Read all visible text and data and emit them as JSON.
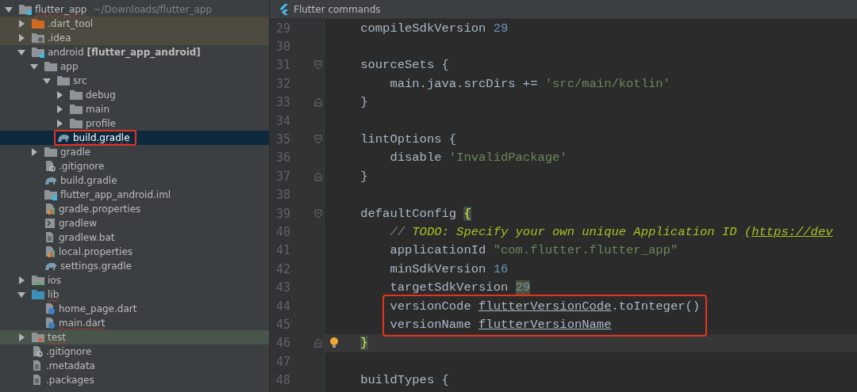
{
  "tree": [
    {
      "name": "flutter_app",
      "kind": "module",
      "path": "~/Downloads/flutter_app",
      "expanded": true,
      "selected": false,
      "typo": true,
      "annotated": false,
      "children": [
        {
          "name": ".dart_tool",
          "kind": "folder-excluded",
          "expanded": false,
          "selected": false,
          "typo": false,
          "annotated": false
        },
        {
          "name": ".idea",
          "kind": "folder-settings",
          "expanded": false,
          "selected": false,
          "typo": false,
          "annotated": false
        },
        {
          "name": "android",
          "kind": "module",
          "module": "[flutter_app_android]",
          "expanded": true,
          "selected": false,
          "typo": false,
          "annotated": false,
          "children": [
            {
              "name": "app",
              "kind": "folder",
              "expanded": true,
              "selected": false,
              "typo": false,
              "annotated": false,
              "children": [
                {
                  "name": "src",
                  "kind": "folder",
                  "expanded": true,
                  "selected": false,
                  "typo": false,
                  "annotated": false,
                  "children": [
                    {
                      "name": "debug",
                      "kind": "folder",
                      "expanded": false,
                      "selected": false,
                      "typo": false,
                      "annotated": false
                    },
                    {
                      "name": "main",
                      "kind": "folder",
                      "expanded": false,
                      "selected": false,
                      "typo": false,
                      "annotated": false
                    },
                    {
                      "name": "profile",
                      "kind": "folder",
                      "expanded": false,
                      "selected": false,
                      "typo": false,
                      "annotated": false
                    }
                  ]
                },
                {
                  "name": "build.gradle",
                  "kind": "gradle",
                  "selected": true,
                  "typo": true,
                  "annotated": true
                }
              ]
            },
            {
              "name": "gradle",
              "kind": "folder",
              "expanded": false,
              "selected": false,
              "typo": false,
              "annotated": false
            },
            {
              "name": ".gitignore",
              "kind": "ignore",
              "selected": false,
              "typo": false,
              "annotated": false
            },
            {
              "name": "build.gradle",
              "kind": "gradle",
              "selected": false,
              "typo": false,
              "annotated": false
            },
            {
              "name": "flutter_app_android.iml",
              "kind": "iml",
              "selected": false,
              "typo": false,
              "annotated": false
            },
            {
              "name": "gradle.properties",
              "kind": "properties",
              "selected": false,
              "typo": false,
              "annotated": false
            },
            {
              "name": "gradlew",
              "kind": "script",
              "selected": false,
              "typo": false,
              "annotated": false
            },
            {
              "name": "gradlew.bat",
              "kind": "text",
              "selected": false,
              "typo": false,
              "annotated": false
            },
            {
              "name": "local.properties",
              "kind": "properties",
              "selected": false,
              "typo": false,
              "annotated": false
            },
            {
              "name": "settings.gradle",
              "kind": "gradle",
              "selected": false,
              "typo": false,
              "annotated": false
            }
          ]
        },
        {
          "name": "ios",
          "kind": "folder-ios",
          "expanded": false,
          "selected": false,
          "typo": false,
          "annotated": false
        },
        {
          "name": "lib",
          "kind": "folder-source",
          "expanded": true,
          "selected": false,
          "typo": true,
          "annotated": false,
          "children": [
            {
              "name": "home_page.dart",
              "kind": "dart",
              "selected": false,
              "typo": false,
              "annotated": false
            },
            {
              "name": "main.dart",
              "kind": "dart",
              "selected": false,
              "typo": true,
              "annotated": false
            }
          ]
        },
        {
          "name": "test",
          "kind": "folder-test",
          "expanded": false,
          "selected": false,
          "typo": true,
          "annotated": false
        },
        {
          "name": ".gitignore",
          "kind": "ignore",
          "selected": false,
          "typo": false,
          "annotated": false
        },
        {
          "name": ".metadata",
          "kind": "text",
          "selected": false,
          "typo": false,
          "annotated": false
        },
        {
          "name": ".packages",
          "kind": "text",
          "selected": false,
          "typo": false,
          "annotated": false
        }
      ]
    }
  ],
  "editor": {
    "toolbar": {
      "title": "Flutter commands"
    },
    "lines": [
      {
        "number": "29",
        "current": false,
        "annotated": false,
        "kind": "plain",
        "tokens": [
          {
            "text": "    compileSdkVersion ",
            "kind": "plain"
          },
          {
            "text": "29",
            "kind": "number"
          }
        ]
      },
      {
        "number": "30",
        "current": false,
        "annotated": false,
        "kind": "plain"
      },
      {
        "number": "31",
        "current": false,
        "annotated": false,
        "kind": "fold-start",
        "tokens": [
          {
            "text": "    sourceSets {",
            "kind": "plain"
          }
        ]
      },
      {
        "number": "32",
        "current": false,
        "annotated": false,
        "kind": "plain",
        "tokens": [
          {
            "text": "        main.java.srcDirs += ",
            "kind": "plain"
          },
          {
            "text": "'src/main/kotlin'",
            "kind": "string"
          }
        ]
      },
      {
        "number": "33",
        "current": false,
        "annotated": false,
        "kind": "fold-end",
        "tokens": [
          {
            "text": "    }",
            "kind": "plain"
          }
        ]
      },
      {
        "number": "34",
        "current": false,
        "annotated": false,
        "kind": "plain"
      },
      {
        "number": "35",
        "current": false,
        "annotated": false,
        "kind": "fold-start",
        "tokens": [
          {
            "text": "    lintOptions {",
            "kind": "plain"
          }
        ]
      },
      {
        "number": "36",
        "current": false,
        "annotated": false,
        "kind": "plain",
        "tokens": [
          {
            "text": "        disable ",
            "kind": "plain"
          },
          {
            "text": "'InvalidPackage'",
            "kind": "string"
          }
        ]
      },
      {
        "number": "37",
        "current": false,
        "annotated": false,
        "kind": "fold-end",
        "tokens": [
          {
            "text": "    }",
            "kind": "plain"
          }
        ]
      },
      {
        "number": "38",
        "current": false,
        "annotated": false,
        "kind": "plain"
      },
      {
        "number": "39",
        "current": false,
        "annotated": false,
        "kind": "fold-start",
        "tokens": [
          {
            "text": "    defaultConfig ",
            "kind": "plain"
          },
          {
            "text": "{",
            "kind": "brace-match"
          }
        ]
      },
      {
        "number": "40",
        "current": false,
        "annotated": false,
        "kind": "plain",
        "tokens": [
          {
            "text": "        // ",
            "kind": "comment"
          },
          {
            "text": "TODO: Specify your own unique Application ID (",
            "kind": "todo"
          },
          {
            "text": "https://dev",
            "kind": "link"
          }
        ]
      },
      {
        "number": "41",
        "current": false,
        "annotated": false,
        "kind": "plain",
        "tokens": [
          {
            "text": "        applicationId ",
            "kind": "plain"
          },
          {
            "text": "\"com.flutter.flutter_app\"",
            "kind": "string"
          }
        ]
      },
      {
        "number": "42",
        "current": false,
        "annotated": false,
        "kind": "plain",
        "tokens": [
          {
            "text": "        minSdkVersion ",
            "kind": "plain"
          },
          {
            "text": "16",
            "kind": "number"
          }
        ]
      },
      {
        "number": "43",
        "current": false,
        "annotated": false,
        "kind": "plain",
        "tokens": [
          {
            "text": "        targetSdkVersion ",
            "kind": "plain"
          },
          {
            "text": "29",
            "kind": "number-highlight"
          }
        ]
      },
      {
        "number": "44",
        "current": false,
        "annotated": true,
        "kind": "plain",
        "tokens": [
          {
            "text": "        versionCode ",
            "kind": "plain"
          },
          {
            "text": "flutterVersionCode",
            "kind": "field"
          },
          {
            "text": ".toInteger()",
            "kind": "plain"
          }
        ]
      },
      {
        "number": "45",
        "current": false,
        "annotated": true,
        "kind": "plain",
        "tokens": [
          {
            "text": "        versionName ",
            "kind": "plain"
          },
          {
            "text": "flutterVersionName",
            "kind": "field"
          }
        ]
      },
      {
        "number": "46",
        "current": true,
        "annotated": false,
        "kind": "fold-end",
        "intention": true,
        "tokens": [
          {
            "text": "    }",
            "kind": "brace-match"
          }
        ]
      },
      {
        "number": "47",
        "current": false,
        "annotated": false,
        "kind": "plain"
      },
      {
        "number": "48",
        "current": false,
        "annotated": false,
        "kind": "plain",
        "tokens": [
          {
            "text": "    buildTypes {",
            "kind": "plain"
          }
        ]
      }
    ]
  }
}
